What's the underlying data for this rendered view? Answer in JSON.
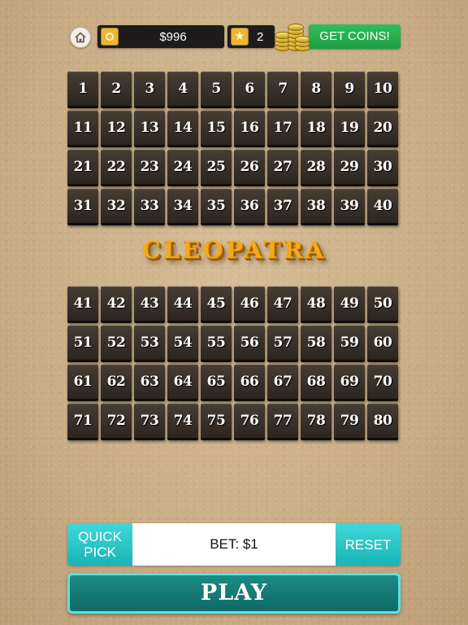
{
  "header": {
    "home_icon": "home-icon",
    "balance_icon": "chip-icon",
    "balance": "$996",
    "stars_icon": "star-icon",
    "stars": "2",
    "coins_icon": "coin-stack-icon",
    "get_coins_label": "GET COINS!"
  },
  "board": {
    "top_numbers": [
      "1",
      "2",
      "3",
      "4",
      "5",
      "6",
      "7",
      "8",
      "9",
      "10",
      "11",
      "12",
      "13",
      "14",
      "15",
      "16",
      "17",
      "18",
      "19",
      "20",
      "21",
      "22",
      "23",
      "24",
      "25",
      "26",
      "27",
      "28",
      "29",
      "30",
      "31",
      "32",
      "33",
      "34",
      "35",
      "36",
      "37",
      "38",
      "39",
      "40"
    ],
    "bottom_numbers": [
      "41",
      "42",
      "43",
      "44",
      "45",
      "46",
      "47",
      "48",
      "49",
      "50",
      "51",
      "52",
      "53",
      "54",
      "55",
      "56",
      "57",
      "58",
      "59",
      "60",
      "61",
      "62",
      "63",
      "64",
      "65",
      "66",
      "67",
      "68",
      "69",
      "70",
      "71",
      "72",
      "73",
      "74",
      "75",
      "76",
      "77",
      "78",
      "79",
      "80"
    ]
  },
  "logo": {
    "text": "CLEOPATRA"
  },
  "controls": {
    "quick_pick_line1": "QUICK",
    "quick_pick_line2": "PICK",
    "bet_label": "BET: $1",
    "reset_label": "RESET",
    "play_label": "PLAY"
  },
  "colors": {
    "tile": "#342c25",
    "accent_teal": "#1ab4b6",
    "get_coins_green": "#23a84d",
    "logo_gold": "#f4a91a",
    "sand": "#cdb28b"
  }
}
